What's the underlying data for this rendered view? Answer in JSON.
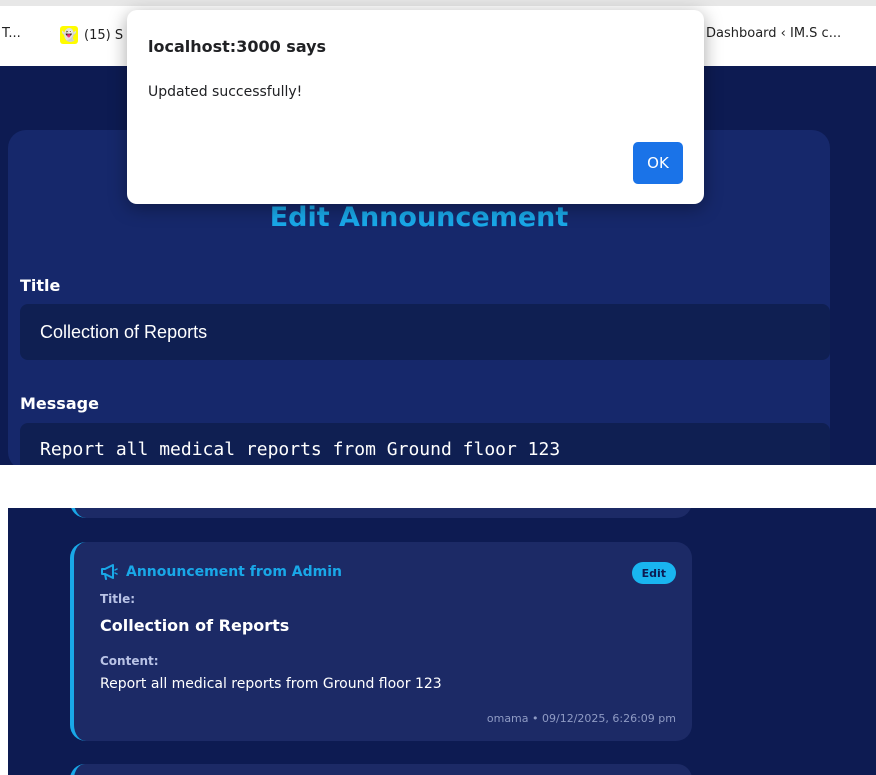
{
  "bookmarks": [
    {
      "label": "T..."
    },
    {
      "label": "(15) S",
      "icon": "snapchat-icon"
    },
    {
      "label": "Dashboard ‹ IM.S c..."
    }
  ],
  "edit_form": {
    "heading": "Edit Announcement",
    "title_label": "Title",
    "title_value": "Collection of Reports",
    "message_label": "Message",
    "message_value": "Report all medical reports from Ground floor 123"
  },
  "dialog": {
    "origin": "localhost:3000 says",
    "message": "Updated successfully!",
    "ok_label": "OK"
  },
  "announcement": {
    "header": "Announcement from Admin",
    "edit_label": "Edit",
    "title_label": "Title:",
    "title": "Collection of Reports",
    "content_label": "Content:",
    "content": "Report all medical reports from Ground floor 123",
    "meta": "omama • 09/12/2025, 6:26:09 pm"
  },
  "colors": {
    "accent": "#19a8e8",
    "app_background": "#0d1b52",
    "card_background": "#16286b",
    "dialog_button": "#1a73e8"
  }
}
